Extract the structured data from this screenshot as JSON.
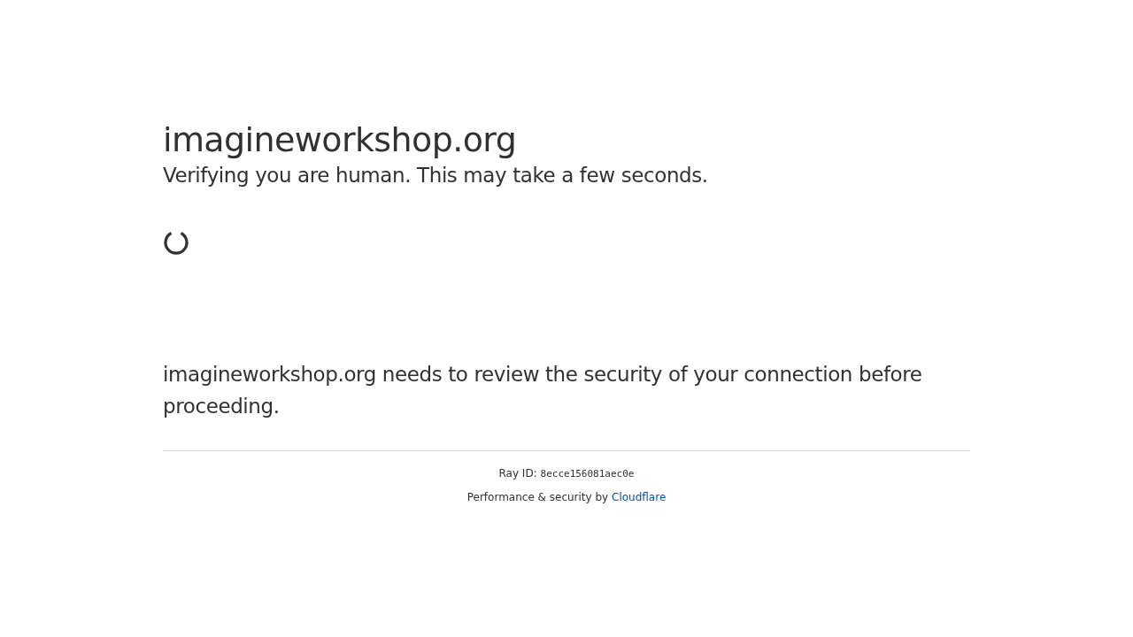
{
  "heading": "imagineworkshop.org",
  "subheading": "Verifying you are human. This may take a few seconds.",
  "message": "imagineworkshop.org needs to review the security of your connection before proceeding.",
  "footer": {
    "ray_label": "Ray ID:",
    "ray_id": "8ecce156081aec0e",
    "credit": "Performance & security by",
    "link": "Cloudflare"
  }
}
